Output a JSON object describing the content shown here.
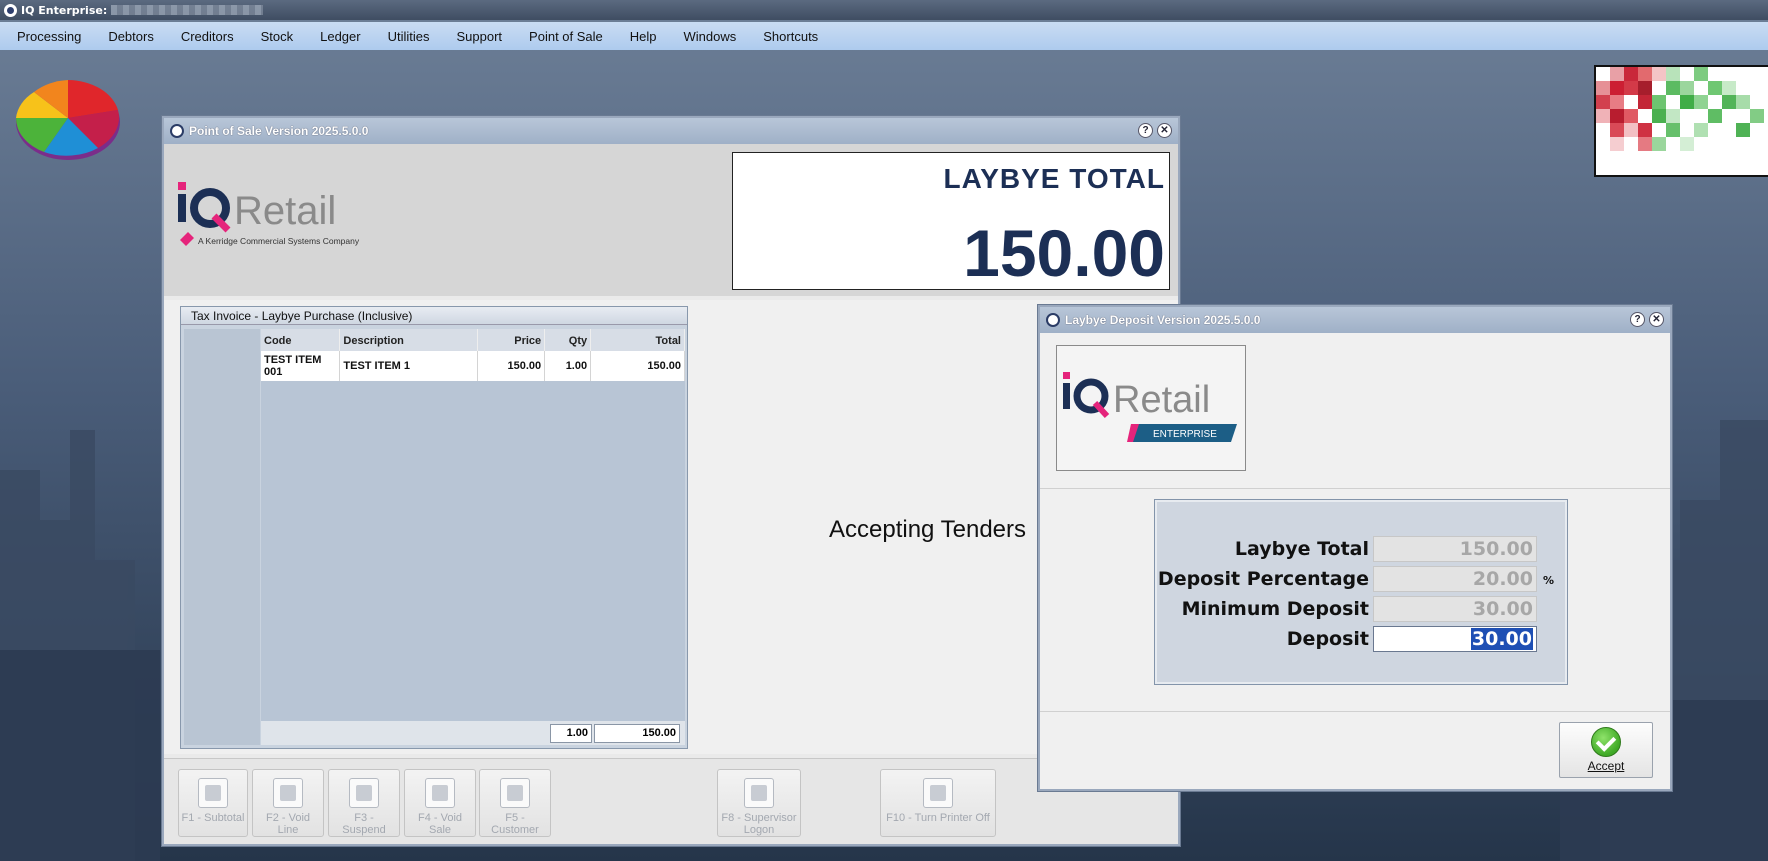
{
  "app": {
    "title": "IQ Enterprise:"
  },
  "menu": [
    "Processing",
    "Debtors",
    "Creditors",
    "Stock",
    "Ledger",
    "Utilities",
    "Support",
    "Point of Sale",
    "Help",
    "Windows",
    "Shortcuts"
  ],
  "pos_window": {
    "title": "Point of Sale Version 2025.5.0.0",
    "logo_sub": "A Kerridge Commercial Systems Company",
    "laybye_title": "LAYBYE TOTAL",
    "laybye_amount": "150.00",
    "invoice_title": "Tax Invoice - Laybye Purchase (Inclusive)",
    "columns": [
      "Code",
      "Description",
      "Price",
      "Qty",
      "Total"
    ],
    "rows": [
      {
        "code": "TEST ITEM 001",
        "description": "TEST ITEM 1",
        "price": "150.00",
        "qty": "1.00",
        "total": "150.00"
      }
    ],
    "footer_qty": "1.00",
    "footer_total": "150.00",
    "status": "Accepting Tenders",
    "fkeys": [
      {
        "label": "F1 - Subtotal"
      },
      {
        "label": "F2 - Void Line"
      },
      {
        "label": "F3 - Suspend"
      },
      {
        "label": "F4 - Void Sale"
      },
      {
        "label": "F5 - Customer"
      },
      {
        "label": "F8 - Supervisor Logon"
      },
      {
        "label": "F10 - Turn Printer Off"
      }
    ]
  },
  "deposit_window": {
    "title": "Laybye Deposit Version 2025.5.0.0",
    "logo_badge": "ENTERPRISE",
    "fields": [
      {
        "label": "Laybye Total",
        "value": "150.00"
      },
      {
        "label": "Deposit Percentage",
        "value": "20.00",
        "unit": "%"
      },
      {
        "label": "Minimum Deposit",
        "value": "30.00"
      },
      {
        "label": "Deposit",
        "value": "30.00"
      }
    ],
    "accept_label": "Accept"
  },
  "colors": {
    "menubar": "#aecbee",
    "laybye_text": "#1c2f55",
    "selection": "#1e4fb4",
    "accept_green": "#3fa926"
  }
}
